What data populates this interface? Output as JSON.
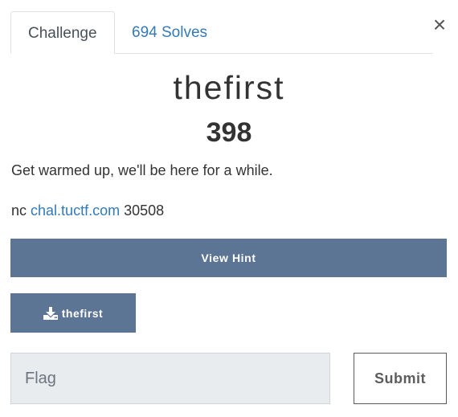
{
  "tabs": [
    {
      "label": "Challenge"
    },
    {
      "label": "694 Solves"
    }
  ],
  "close_label": "×",
  "challenge": {
    "title": "thefirst",
    "value": "398",
    "description": "Get warmed up, we'll be here for a while.",
    "connection": {
      "prefix": "nc",
      "host": "chal.tuctf.com",
      "port": "30508"
    }
  },
  "hint_button": {
    "label": "View Hint"
  },
  "file_button": {
    "label": "thefirst",
    "icon": "download-icon"
  },
  "flag_input": {
    "placeholder": "Flag",
    "value": ""
  },
  "submit_button": {
    "label": "Submit"
  },
  "colors": {
    "button_bg": "#5d7594",
    "link": "#337ab7",
    "input_bg": "#e9ecef"
  }
}
